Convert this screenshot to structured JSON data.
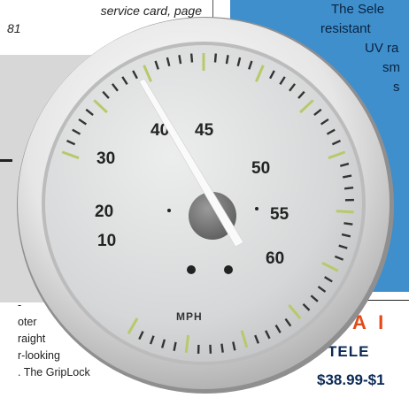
{
  "left_page": {
    "caption_line1": "service card, page",
    "caption_line2": "81",
    "body_lines": [
      "-",
      "oter",
      "raight",
      "r-looking",
      ". The GripLock"
    ]
  },
  "right_page": {
    "text_lines": [
      "The Sele",
      "resistant",
      "UV ra",
      "sm",
      "s"
    ],
    "ad_heading": "A I",
    "ad_sub": "TELE",
    "ad_price": "$38.99-$1"
  },
  "gauge": {
    "unit": "MPH",
    "main_scale": [
      "10",
      "20",
      "30",
      "40",
      "45",
      "50",
      "55",
      "60"
    ],
    "needle_value": 40,
    "colors": {
      "face": "#d9dadb",
      "bezel": "#ececec",
      "numerals": "#222222",
      "accent": "#b8c96a"
    }
  }
}
